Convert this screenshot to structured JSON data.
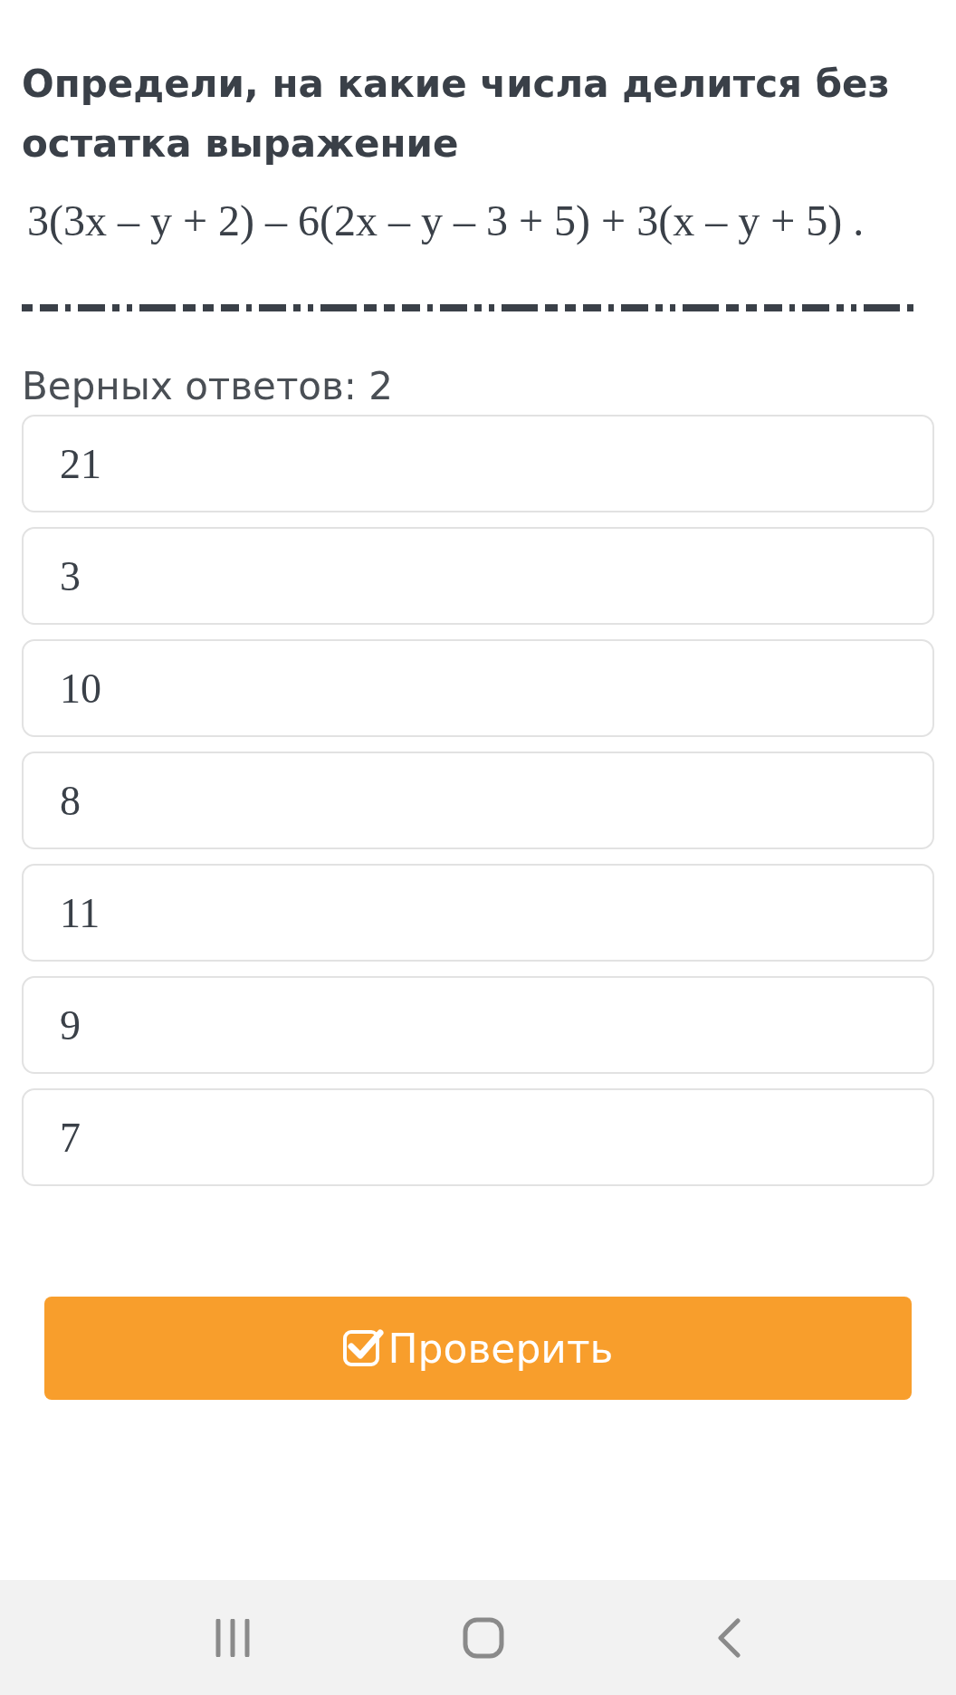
{
  "question": {
    "title": "Определи, на какие числа делится без остатка выражение",
    "expression": "3(3x – y + 2) – 6(2x – y – 3 + 5) + 3(x – y + 5) ."
  },
  "answers_hint": "Верных ответов: 2",
  "options": [
    {
      "label": "21",
      "selected": false
    },
    {
      "label": "3",
      "selected": false
    },
    {
      "label": "10",
      "selected": false
    },
    {
      "label": "8",
      "selected": false
    },
    {
      "label": "11",
      "selected": false
    },
    {
      "label": "9",
      "selected": false
    },
    {
      "label": "7",
      "selected": false
    }
  ],
  "submit_button": "Проверить"
}
